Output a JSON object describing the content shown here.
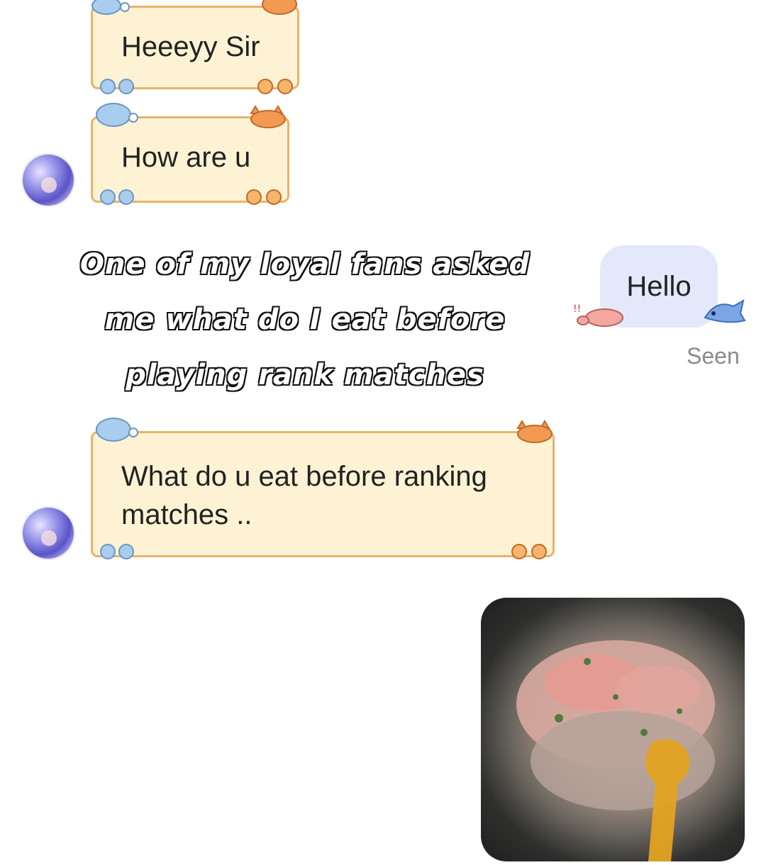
{
  "messages": {
    "m1": "Heeeyy Sir",
    "m2": "How are u",
    "m3": "What do u eat before ranking\nmatches .."
  },
  "outgoing": {
    "hello": "Hello",
    "status": "Seen"
  },
  "caption": {
    "line1": "One of my loyal fans asked",
    "line2": "me what do I eat before",
    "line3": "playing rank matches"
  },
  "icons": {
    "bubble_decor": [
      "dog-icon",
      "cat-icon",
      "paw-icon"
    ],
    "outgoing_decor": [
      "pig-icon",
      "shark-icon"
    ],
    "avatar": "avatar-icon"
  },
  "colors": {
    "bubble_bg": "#fdf3d4",
    "bubble_border": "#e7b36a",
    "outgoing_bg": "#e3e9fb",
    "seen": "#8a8a8a"
  }
}
